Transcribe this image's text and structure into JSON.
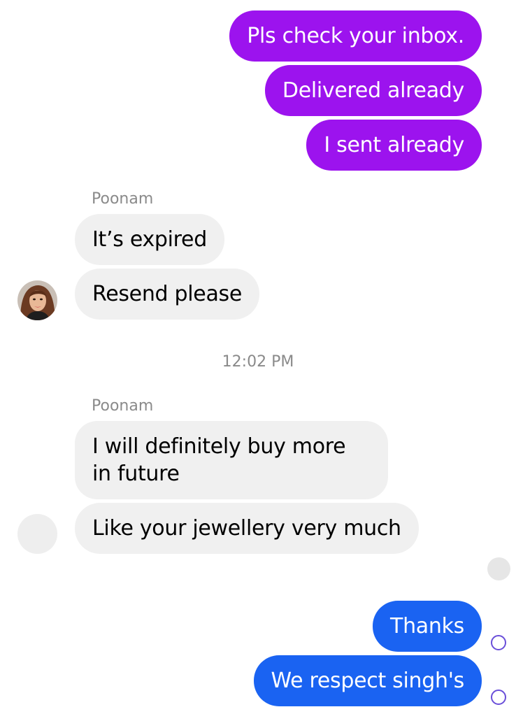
{
  "messages": {
    "outgoing_1": "Pls check your inbox.",
    "outgoing_2": "Delivered already",
    "outgoing_3": "I sent already",
    "sender_1": "Poonam",
    "incoming_1": "It’s expired",
    "incoming_2": "Resend please",
    "timestamp": "12:02 PM",
    "sender_2": "Poonam",
    "incoming_3": "I will definitely buy more in future",
    "incoming_4": "Like your jewellery very much",
    "outgoing_4": "Thanks",
    "outgoing_5": "We respect singh's"
  },
  "icons": {
    "contact_avatar": "contact-avatar-photo",
    "placeholder_avatar": "avatar-placeholder",
    "seen_indicator": "seen-indicator",
    "sent_status": "sent-status-ring"
  },
  "colors": {
    "outgoing_purple": "#9c13ee",
    "outgoing_blue": "#1a63f2",
    "incoming_bg": "#f0f0f0",
    "meta_text": "#8a8a8a",
    "status_ring": "#6a4fd9"
  }
}
